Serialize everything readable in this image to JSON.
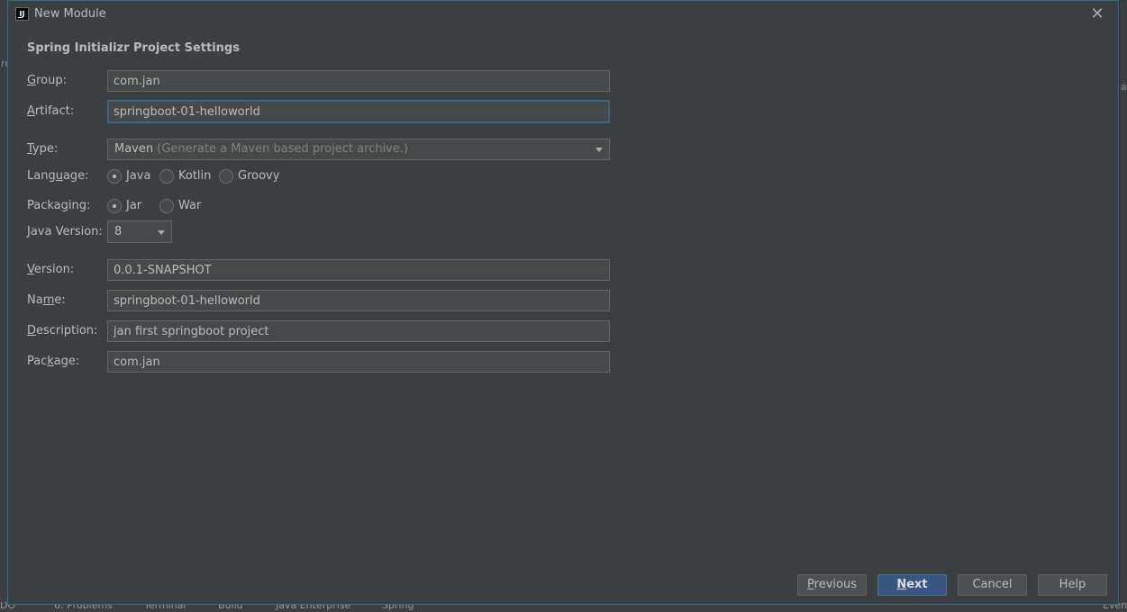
{
  "window": {
    "title": "New Module"
  },
  "section_title": "Spring Initializr Project Settings",
  "fields": {
    "group": {
      "label_mn": "G",
      "label_rest": "roup:",
      "value": "com.jan"
    },
    "artifact": {
      "label_mn": "A",
      "label_rest": "rtifact:",
      "value": "springboot-01-helloworld"
    },
    "version": {
      "label_mn": "V",
      "label_rest": "ersion:",
      "value": "0.0.1-SNAPSHOT"
    },
    "name": {
      "label_pre": "Na",
      "label_mn": "m",
      "label_rest": "e:",
      "value": "springboot-01-helloworld"
    },
    "description": {
      "label_mn": "D",
      "label_rest": "escription:",
      "value": "jan first springboot project"
    },
    "package": {
      "label_pre": "Pac",
      "label_mn": "k",
      "label_rest": "age:",
      "value": "com.jan"
    }
  },
  "type": {
    "label_mn": "T",
    "label_rest": "ype:",
    "selected": "Maven",
    "hint": "(Generate a Maven based project archive.)"
  },
  "language": {
    "label_pre": "Lang",
    "label_mn": "u",
    "label_rest": "age:",
    "options": [
      "Java",
      "Kotlin",
      "Groovy"
    ],
    "selected": "Java"
  },
  "packaging": {
    "label_pre": "Packa",
    "label_mn": "g",
    "label_rest": "ing:",
    "options": [
      "Jar",
      "War"
    ],
    "selected": "Jar"
  },
  "java_version": {
    "label_mn": "J",
    "label_rest": "ava Version:",
    "selected": "8"
  },
  "buttons": {
    "previous": {
      "mn": "P",
      "rest": "revious"
    },
    "next": {
      "mn": "N",
      "rest": "ext"
    },
    "cancel": "Cancel",
    "help": "Help"
  },
  "background": {
    "bottom_tabs": [
      "DO",
      "6: Problems",
      "Terminal",
      "Build",
      "Java Enterprise",
      "Spring",
      "Even"
    ],
    "left_frag": "re",
    "right_frag": "ac"
  }
}
